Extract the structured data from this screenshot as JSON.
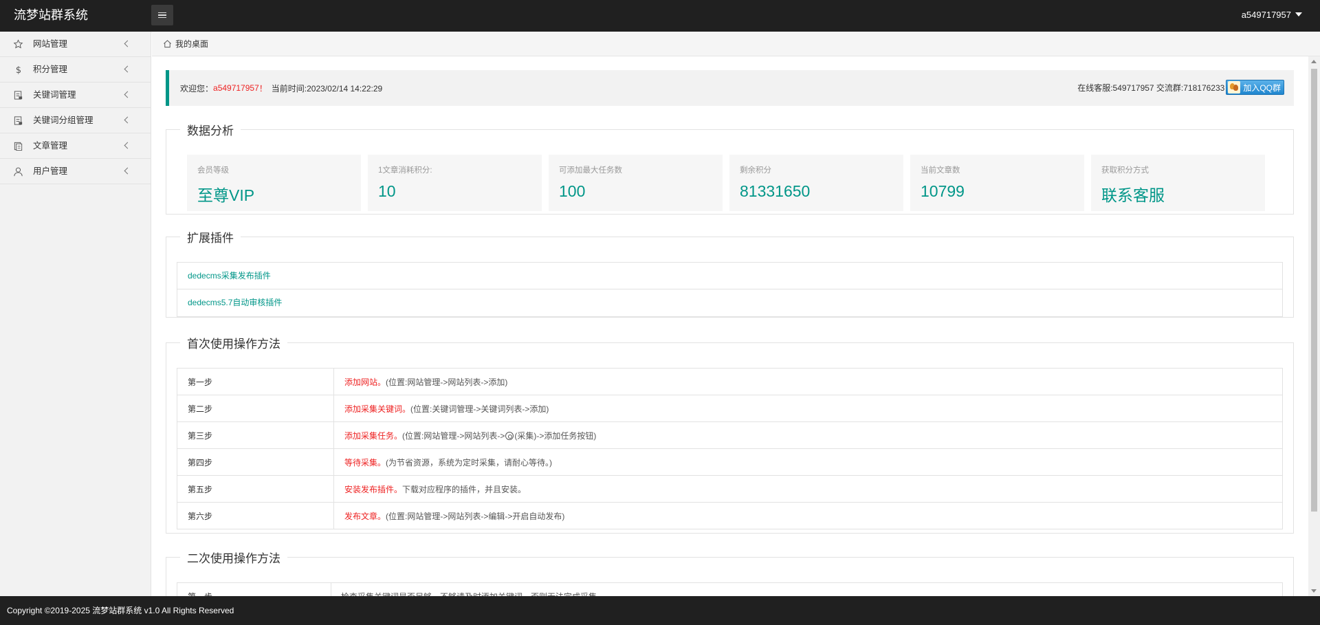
{
  "header": {
    "brand": "流梦站群系统",
    "username": "a549717957"
  },
  "sidebar": {
    "items": [
      {
        "label": "网站管理",
        "icon": "star-icon"
      },
      {
        "label": "积分管理",
        "icon": "dollar-icon"
      },
      {
        "label": "关键词管理",
        "icon": "document-icon"
      },
      {
        "label": "关键词分组管理",
        "icon": "document-icon"
      },
      {
        "label": "文章管理",
        "icon": "copy-icon"
      },
      {
        "label": "用户管理",
        "icon": "user-icon"
      }
    ]
  },
  "breadcrumb": {
    "home_label": "我的桌面"
  },
  "welcome": {
    "prefix": "欢迎您：",
    "username": "a549717957",
    "exclaim": "！",
    "time_label": "当前时间:2023/02/14 14:22:29",
    "contact": "在线客服:549717957 交流群:718176233",
    "qq_button": "加入QQ群"
  },
  "analysis": {
    "title": "数据分析",
    "stats": [
      {
        "label": "会员等级",
        "value": "至尊VIP"
      },
      {
        "label": "1文章消耗积分:",
        "value": "10"
      },
      {
        "label": "可添加最大任务数",
        "value": "100"
      },
      {
        "label": "剩余积分",
        "value": "81331650"
      },
      {
        "label": "当前文章数",
        "value": "10799"
      },
      {
        "label": "获取积分方式",
        "value": "联系客服"
      }
    ]
  },
  "plugins": {
    "title": "扩展插件",
    "items": [
      "dedecms采集发布插件",
      "dedecms5.7自动审核插件"
    ]
  },
  "first_use": {
    "title": "首次使用操作方法",
    "steps": [
      {
        "step": "第一步",
        "action": "添加网站。",
        "note": "(位置:网站管理->网站列表->添加)"
      },
      {
        "step": "第二步",
        "action": "添加采集关键词。",
        "note": "(位置:关键词管理->关键词列表->添加)"
      },
      {
        "step": "第三步",
        "action": "添加采集任务。",
        "note_a": "(位置:网站管理->网站列表->",
        "note_b": "(采集)->添加任务按钮)"
      },
      {
        "step": "第四步",
        "action": "等待采集。",
        "note": "(为节省资源，系统为定时采集，请耐心等待。)"
      },
      {
        "step": "第五步",
        "action": "安装发布插件。",
        "note": "下载对应程序的插件，并且安装。"
      },
      {
        "step": "第六步",
        "action": "发布文章。",
        "note": "(位置:网站管理->网站列表->编辑->开启自动发布)"
      }
    ]
  },
  "second_use": {
    "title": "二次使用操作方法",
    "steps": [
      {
        "step": "第一步",
        "note": "检查采集关键词是否足够，不够请及时添加关键词，否则无法完成采集。"
      }
    ]
  },
  "footer": {
    "copyright": "Copyright ©2019-2025 流梦站群系统 v1.0 All Rights Reserved"
  },
  "colors": {
    "accent": "#009688",
    "highlight": "#ee2222",
    "header_bg": "#202020"
  }
}
